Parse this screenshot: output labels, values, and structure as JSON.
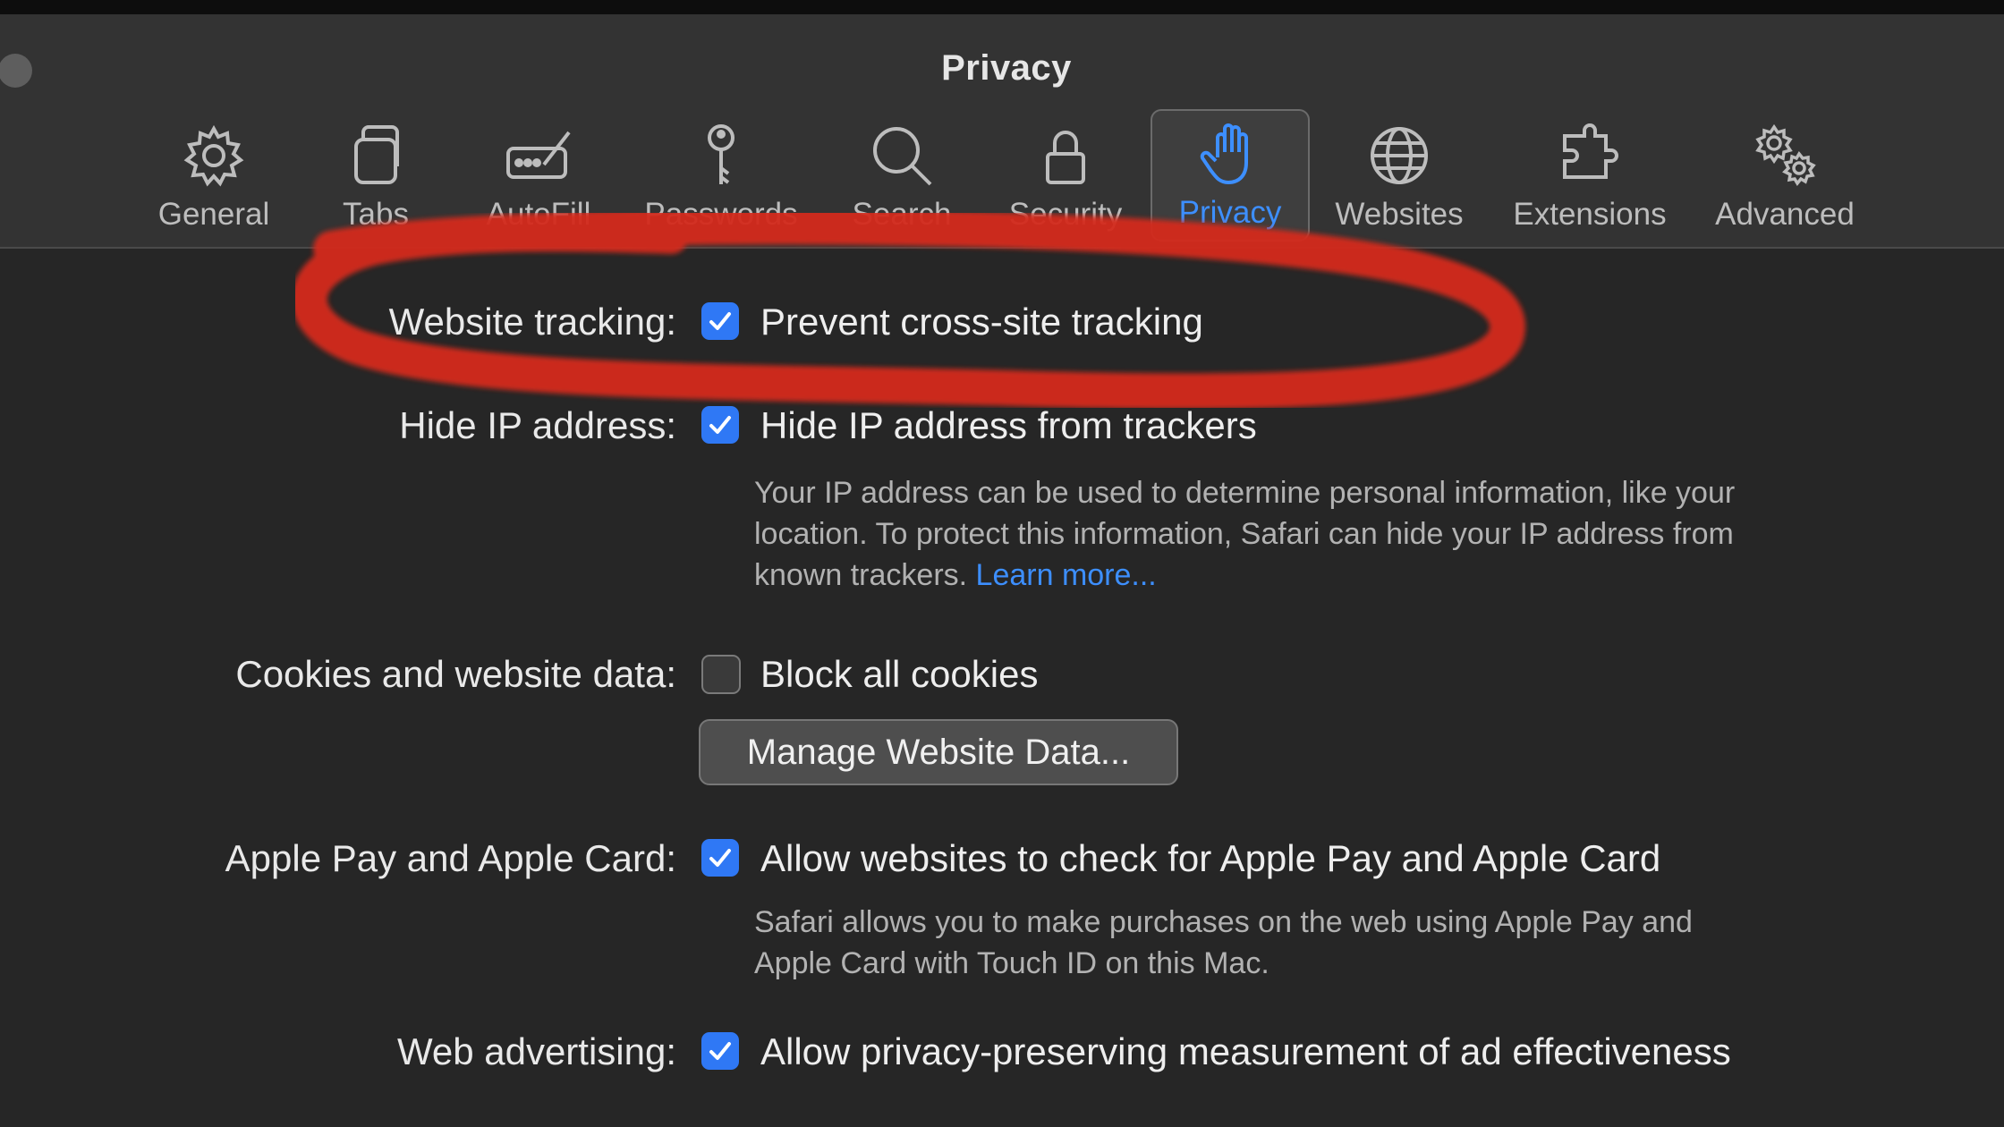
{
  "window": {
    "title": "Privacy"
  },
  "tabs": [
    {
      "label": "General",
      "icon": "gear-icon"
    },
    {
      "label": "Tabs",
      "icon": "tabs-icon"
    },
    {
      "label": "AutoFill",
      "icon": "autofill-icon"
    },
    {
      "label": "Passwords",
      "icon": "key-icon"
    },
    {
      "label": "Search",
      "icon": "search-icon"
    },
    {
      "label": "Security",
      "icon": "lock-icon"
    },
    {
      "label": "Privacy",
      "icon": "hand-icon",
      "selected": true
    },
    {
      "label": "Websites",
      "icon": "globe-icon"
    },
    {
      "label": "Extensions",
      "icon": "puzzle-icon"
    },
    {
      "label": "Advanced",
      "icon": "gears-icon"
    }
  ],
  "settings": {
    "website_tracking": {
      "label": "Website tracking:",
      "option": "Prevent cross-site tracking",
      "checked": true
    },
    "hide_ip": {
      "label": "Hide IP address:",
      "option": "Hide IP address from trackers",
      "checked": true,
      "description": "Your IP address can be used to determine personal information, like your location. To protect this information, Safari can hide your IP address from known trackers.",
      "link": "Learn more..."
    },
    "cookies": {
      "label": "Cookies and website data:",
      "option": "Block all cookies",
      "checked": false,
      "button": "Manage Website Data..."
    },
    "apple_pay": {
      "label": "Apple Pay and Apple Card:",
      "option": "Allow websites to check for Apple Pay and Apple Card",
      "checked": true,
      "description": "Safari allows you to make purchases on the web using Apple Pay and Apple Card with Touch ID on this Mac."
    },
    "web_advertising": {
      "label": "Web advertising:",
      "option": "Allow privacy-preserving measurement of ad effectiveness",
      "checked": true
    }
  },
  "colors": {
    "accent": "#2f78f5",
    "link": "#3d8fff",
    "annotation": "#d42a1e",
    "background": "#262626",
    "toolbar": "#333333"
  }
}
